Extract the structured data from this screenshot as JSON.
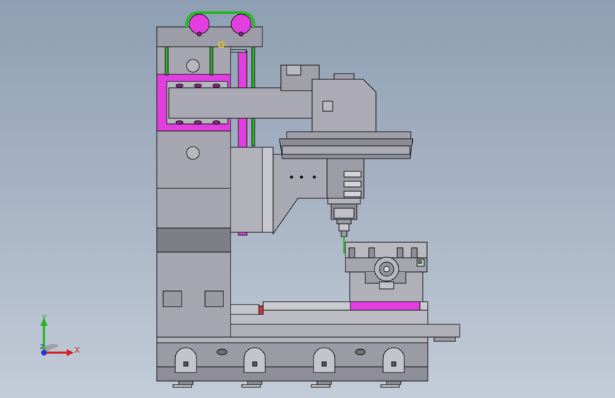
{
  "viewport": {
    "background_top": "#8e9fb3",
    "background_bottom": "#c3ccd8",
    "model_fill": "#a3a3ad",
    "model_stroke": "#1c1c1c",
    "highlight_color": "#e33ee0",
    "accent_green": "#2bb52b",
    "hole_color": "#8b1f8b"
  },
  "triad": {
    "x_label": "X",
    "y_label": "Y",
    "z_label": "Z",
    "x_color": "#d42222",
    "y_color": "#27b227",
    "z_color": "#2a36c8"
  }
}
